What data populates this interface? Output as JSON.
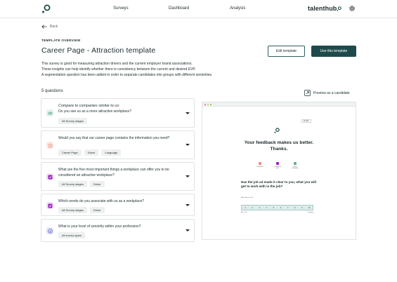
{
  "nav": {
    "items": [
      "Surveys",
      "Dashboard",
      "Analysis"
    ],
    "brand": "talenthub"
  },
  "back_label": "Back",
  "overline": "TEMPLATE OVERVIEW",
  "title": "Career Page - Attraction template",
  "actions": {
    "edit": "Edit template",
    "use": "Use this template"
  },
  "description": [
    "This survey is good for measuring attraction drivers and the current employer brand associations.",
    "These insights can help identify whether there is consistency between the current and desired EVP.",
    "A segmentation question has been added in order to separate candidates into groups with different seniorities."
  ],
  "question_count": "5 questions",
  "questions": [
    {
      "group": "Compare to companies similar to us:",
      "text": "Do you see us as a more attractive workplace?",
      "tags": [
        "All Survey stages"
      ],
      "icon": "compare-icon",
      "icon_color": "#5fb08f",
      "icon_bg": "#e3f2ea"
    },
    {
      "group": "",
      "text": "Would you say that our career page contains the information you need?",
      "tags": [
        "Career Page",
        "Driver",
        "Language"
      ],
      "icon": "star-icon",
      "icon_color": "#f08a7a",
      "icon_bg": "#fde8e3"
    },
    {
      "group": "",
      "text": "What are the five most important things a workplace can offer you to be considered an attractive workplace?",
      "tags": [
        "All Survey stages",
        "Driver"
      ],
      "icon": "multiple-choice-icon",
      "icon_color": "#a11fc4",
      "icon_bg": "#f1e0f6"
    },
    {
      "group": "",
      "text": "Which words do you associate with us as a workplace?",
      "tags": [
        "All Survey stages",
        "Driver"
      ],
      "icon": "multiple-choice-icon",
      "icon_color": "#a11fc4",
      "icon_bg": "#f1e0f6"
    },
    {
      "group": "",
      "text": "What is your level of seniority within your profession?",
      "tags": [
        "All survey types"
      ],
      "icon": "single-choice-icon",
      "icon_color": "#5d63d6",
      "icon_bg": "#e4e5fa"
    }
  ],
  "preview": {
    "link_label": "Preview as a candidate",
    "language": "English",
    "headline_1": "Your feedback makes us better.",
    "headline_2": "Thanks.",
    "icons": [
      {
        "label": "Competitive",
        "color": "#f08a7a"
      },
      {
        "label": "Quickest job offer",
        "color": "#a11fc4"
      },
      {
        "label": "Salary information",
        "color": "#5fb08f"
      }
    ],
    "question": "Has the job ad made it clear to you, what you will get to work with in the job?",
    "prefix": "Rate from 1 to 10",
    "scale": [
      "1",
      "2",
      "3",
      "4",
      "5",
      "6",
      "7",
      "8",
      "9",
      "10"
    ],
    "scale_low": "Not at all",
    "scale_high": "Definitely"
  },
  "colors": {
    "primary": "#1e4a4c",
    "border": "#dfe3e3",
    "tag_bg": "#eef0f0"
  }
}
